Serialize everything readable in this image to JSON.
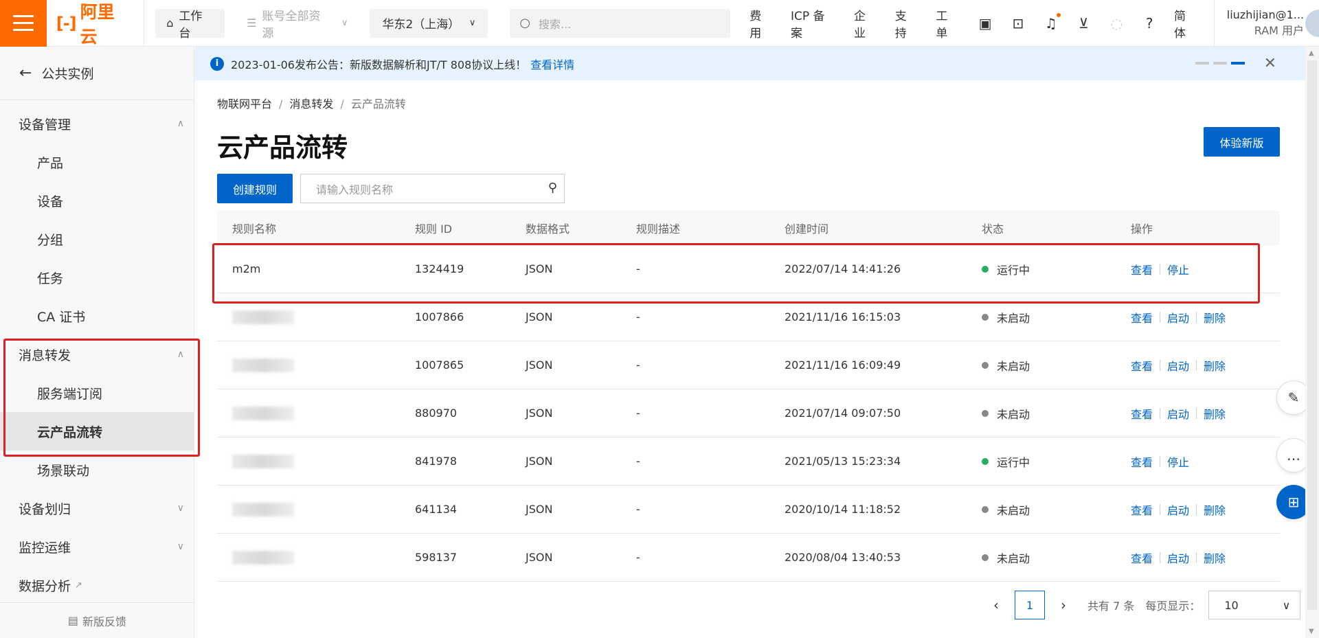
{
  "header": {
    "logo_text": "阿里云",
    "workbench": "工作台",
    "resources": "账号全部资源",
    "region": "华东2（上海）",
    "search_placeholder": "搜索...",
    "links": [
      "费用",
      "ICP 备案",
      "企业",
      "支持",
      "工单"
    ],
    "lang": "简体",
    "user_name": "liuzhijian@1...",
    "user_role": "RAM 用户"
  },
  "sidebar": {
    "back": "公共实例",
    "groups": [
      {
        "label": "设备管理",
        "items": [
          "产品",
          "设备",
          "分组",
          "任务",
          "CA 证书"
        ]
      },
      {
        "label": "消息转发",
        "items": [
          "服务端订阅",
          "云产品流转",
          "场景联动"
        ]
      },
      {
        "label": "设备划归"
      },
      {
        "label": "监控运维"
      },
      {
        "label": "数据分析"
      }
    ],
    "feedback": "新版反馈"
  },
  "notice": {
    "text": "2023-01-06发布公告：新版数据解析和JT/T 808协议上线！",
    "link": "查看详情"
  },
  "breadcrumb": [
    "物联网平台",
    "消息转发",
    "云产品流转"
  ],
  "page_title": "云产品流转",
  "btn_new_version": "体验新版",
  "btn_create": "创建规则",
  "rule_search_placeholder": "请输入规则名称",
  "table": {
    "headers": [
      "规则名称",
      "规则 ID",
      "数据格式",
      "规则描述",
      "创建时间",
      "状态",
      "操作"
    ],
    "rows": [
      {
        "name": "m2m",
        "id": "1324419",
        "format": "JSON",
        "desc": "-",
        "time": "2022/07/14 14:41:26",
        "status": "运行中",
        "ops": [
          "查看",
          "停止"
        ]
      },
      {
        "name": "",
        "id": "1007866",
        "format": "JSON",
        "desc": "-",
        "time": "2021/11/16 16:15:03",
        "status": "未启动",
        "ops": [
          "查看",
          "启动",
          "删除"
        ]
      },
      {
        "name": "",
        "id": "1007865",
        "format": "JSON",
        "desc": "-",
        "time": "2021/11/16 16:09:49",
        "status": "未启动",
        "ops": [
          "查看",
          "启动",
          "删除"
        ]
      },
      {
        "name": "",
        "id": "880970",
        "format": "JSON",
        "desc": "-",
        "time": "2021/07/14 09:07:50",
        "status": "未启动",
        "ops": [
          "查看",
          "启动",
          "删除"
        ]
      },
      {
        "name": "",
        "id": "841978",
        "format": "JSON",
        "desc": "-",
        "time": "2021/05/13 15:23:34",
        "status": "运行中",
        "ops": [
          "查看",
          "停止"
        ]
      },
      {
        "name": "",
        "id": "641134",
        "format": "JSON",
        "desc": "-",
        "time": "2020/10/14 11:18:52",
        "status": "未启动",
        "ops": [
          "查看",
          "启动",
          "删除"
        ]
      },
      {
        "name": "",
        "id": "598137",
        "format": "JSON",
        "desc": "-",
        "time": "2020/08/04 13:40:53",
        "status": "未启动",
        "ops": [
          "查看",
          "启动",
          "删除"
        ]
      }
    ]
  },
  "pagination": {
    "current": "1",
    "total": "共有 7 条",
    "per_page_label": "每页显示：",
    "per_page": "10"
  },
  "colors": {
    "brand": "#ff6a00",
    "primary": "#0064c8",
    "running": "#23b066",
    "stopped": "#888888",
    "highlight": "#e02020"
  }
}
